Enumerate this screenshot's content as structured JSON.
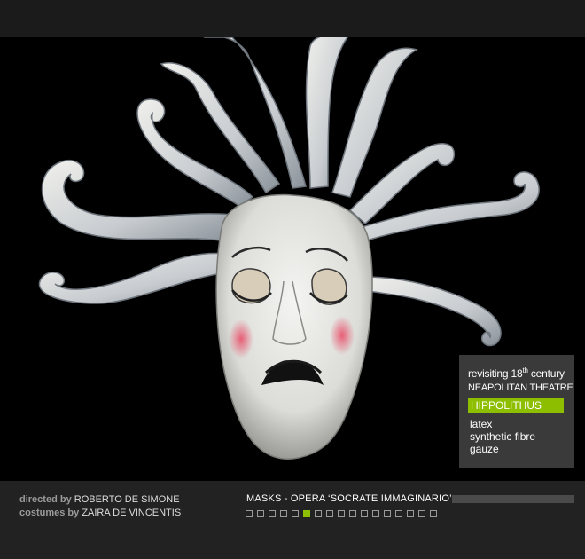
{
  "info": {
    "line1_prefix": "revisiting 18",
    "line1_sup": "th",
    "line1_suffix": " century",
    "line2": "NEAPOLITAN THEATRE",
    "mask_name": "HIPPOLITHUS",
    "materials": [
      "latex",
      "synthetic fibre",
      "gauze"
    ]
  },
  "credits": {
    "directed_label": "directed by",
    "director": "ROBERTO DE SIMONE",
    "costumes_label": "costumes by",
    "costumer": "ZAIRA DE VINCENTIS"
  },
  "gallery": {
    "title": "MASKS  -  OPERA ‘SOCRATE IMMAGINARIO’",
    "page_count": 17,
    "active_page": 6,
    "progress": 0
  },
  "colors": {
    "accent": "#8dbf00",
    "panel": "#3a3a3a",
    "footer": "#222222"
  }
}
